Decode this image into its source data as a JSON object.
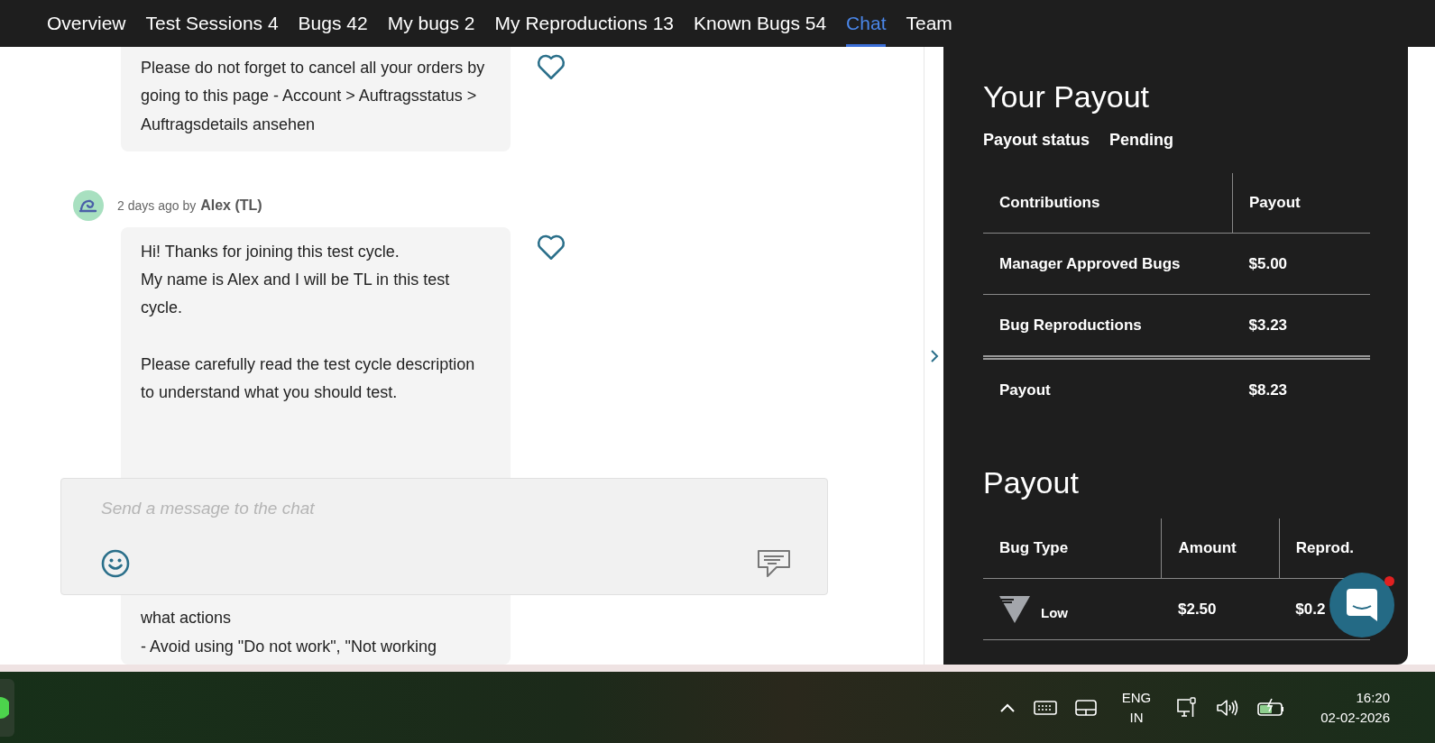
{
  "nav": {
    "tabs": [
      {
        "label": "Overview",
        "selected": false
      },
      {
        "label": "Test Sessions 4",
        "selected": false
      },
      {
        "label": "Bugs 42",
        "selected": false
      },
      {
        "label": "My bugs 2",
        "selected": false
      },
      {
        "label": "My Reproductions 13",
        "selected": false
      },
      {
        "label": "Known Bugs 54",
        "selected": false
      },
      {
        "label": "Chat",
        "selected": true
      },
      {
        "label": "Team",
        "selected": false
      }
    ]
  },
  "chat": {
    "messages": [
      {
        "paragraphs": [
          "Please do not forget to cancel all your orders by going to this page - Account > Auftragsstatus > Auftragsdetails ansehen"
        ],
        "liked": false
      },
      {
        "time": "2 days ago by",
        "author": "Alex (TL)",
        "paragraphs": [
          "Hi! Thanks for joining this test cycle.\nMy name is Alex and I will be TL in this test cycle.",
          "Please carefully read the test cycle description to understand what you should test."
        ],
        "after_composer": "what actions\n- Avoid using \"Do not work\", \"Not working",
        "liked": false
      }
    ],
    "composer": {
      "placeholder": "Send a message to the chat"
    }
  },
  "payout_summary": {
    "title": "Your Payout",
    "status_label": "Payout status",
    "status_value": "Pending",
    "columns": [
      "Contributions",
      "Payout"
    ],
    "rows": [
      [
        "Manager Approved Bugs",
        "$5.00"
      ],
      [
        "Bug Reproductions",
        "$3.23"
      ]
    ],
    "total": [
      "Payout",
      "$8.23"
    ]
  },
  "payout_rates": {
    "title": "Payout",
    "columns": [
      "Bug Type",
      "Amount",
      "Reprod."
    ],
    "rows": [
      {
        "type": "Low",
        "amount": "$2.50",
        "reprod": "$0.2"
      }
    ]
  },
  "chat_widget": {
    "has_notification": true
  },
  "taskbar": {
    "language": "ENG",
    "region": "IN",
    "time": "16:20",
    "date": "02-02-2026"
  }
}
